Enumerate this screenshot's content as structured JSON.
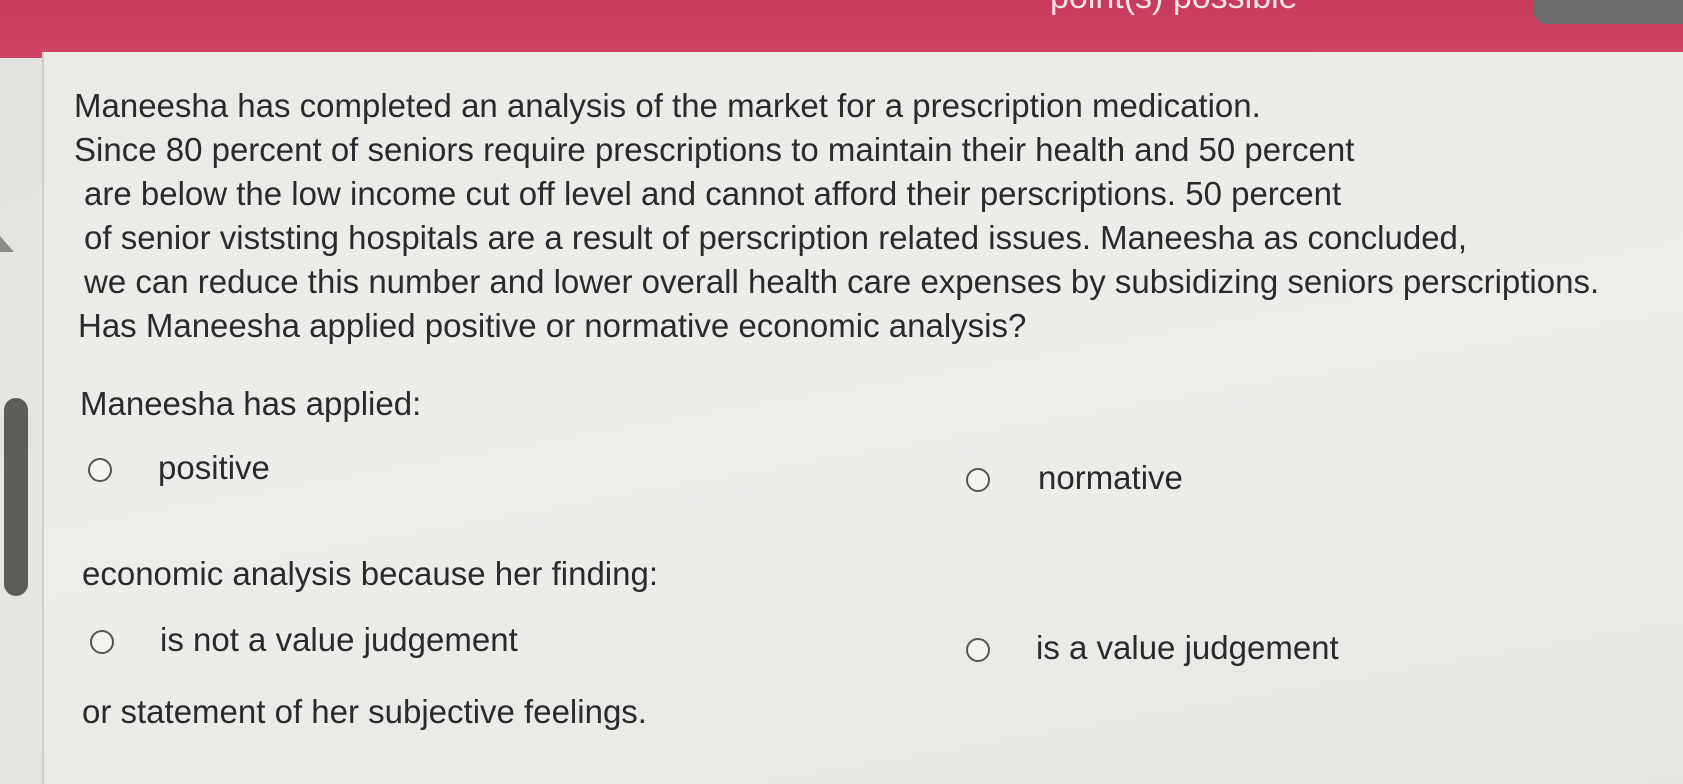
{
  "header": {
    "points_label": "point(s) possible"
  },
  "question": {
    "lines": [
      "Maneesha has completed an analysis of the market for a prescription medication.",
      "Since 80 percent of seniors require prescriptions to maintain their health and 50 percent",
      "are below the low income cut off level and cannot afford their perscriptions. 50 percent",
      "of senior viststing hospitals are a result of perscription related issues. Maneesha as concluded,",
      "we can reduce this number and lower overall health care expenses by subsidizing seniors perscriptions.",
      "Has Maneesha applied positive or normative economic analysis?"
    ]
  },
  "part1": {
    "prompt": "Maneesha has applied:",
    "options": [
      "positive",
      "normative"
    ]
  },
  "part2": {
    "prompt": "economic analysis because her finding:",
    "options": [
      "is not a value judgement",
      "is a value judgement"
    ],
    "suffix": "or statement of her subjective feelings."
  }
}
